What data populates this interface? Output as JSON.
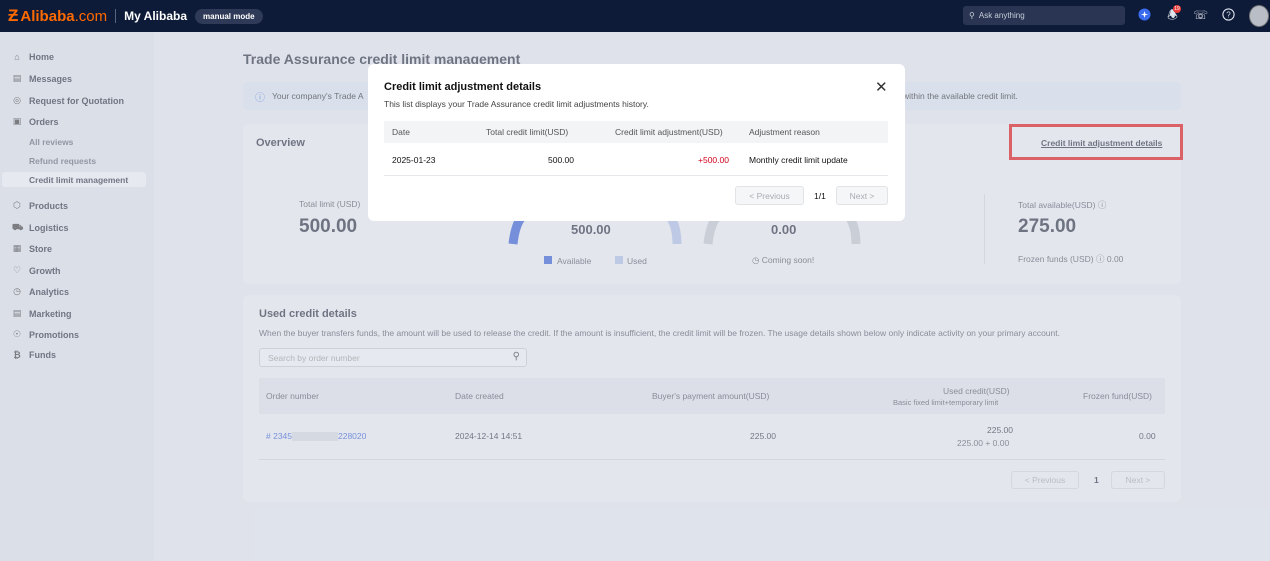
{
  "topbar": {
    "brand_mark": "Ƶ",
    "brand_name": "Alibaba",
    "brand_suffix": ".com",
    "app_name": "My Alibaba",
    "mode_pill": "manual mode",
    "search_placeholder": "Ask anything",
    "notification_count": "19"
  },
  "sidebar": {
    "items": [
      {
        "label": "Home",
        "icon": "home-icon"
      },
      {
        "label": "Messages",
        "icon": "message-icon"
      },
      {
        "label": "Request for Quotation",
        "icon": "rfq-icon"
      },
      {
        "label": "Orders",
        "icon": "orders-icon"
      },
      {
        "label": "Products",
        "icon": "products-icon"
      },
      {
        "label": "Logistics",
        "icon": "logistics-icon"
      },
      {
        "label": "Store",
        "icon": "store-icon"
      },
      {
        "label": "Growth",
        "icon": "growth-icon"
      },
      {
        "label": "Analytics",
        "icon": "analytics-icon"
      },
      {
        "label": "Marketing",
        "icon": "marketing-icon"
      },
      {
        "label": "Promotions",
        "icon": "promotions-icon"
      },
      {
        "label": "Funds",
        "icon": "funds-icon"
      }
    ],
    "sub_items": [
      "All reviews",
      "Refund requests",
      "Credit limit management"
    ]
  },
  "main": {
    "title": "Trade Assurance credit limit management",
    "notice_start": "Your company's Trade A",
    "notice_end": "within the available credit limit."
  },
  "overview": {
    "title": "Overview",
    "details_link": "Credit limit adjustment details",
    "total_limit_label": "Total limit (USD)",
    "total_limit_value": "500.00",
    "available_value": "500.00",
    "frozen_center_value": "0.00",
    "legend_available": "Available",
    "legend_used": "Used",
    "coming_soon": "Coming soon!",
    "total_available_label": "Total available(USD)",
    "total_available_value": "275.00",
    "frozen_funds_label": "Frozen funds (USD)",
    "frozen_funds_value": "0.00"
  },
  "used_credit": {
    "title": "Used credit details",
    "description": "When the buyer transfers funds, the amount will be used to release the credit. If the amount is insufficient, the credit limit will be frozen. The usage details shown below only indicate activity on your primary account.",
    "search_placeholder": "Search by order number",
    "headers": {
      "order_number": "Order number",
      "date_created": "Date created",
      "buyer_payment": "Buyer's payment amount(USD)",
      "used_credit": "Used credit(USD)",
      "used_credit_sub": "Basic fixed limit+temporary limit",
      "frozen_fund": "Frozen fund(USD)"
    },
    "row": {
      "order_prefix": "# 2345",
      "order_suffix": "228020",
      "date_created": "2024-12-14 14:51",
      "buyer_payment": "225.00",
      "used_credit": "225.00",
      "used_credit_breakdown": "225.00 + 0.00",
      "frozen_fund": "0.00"
    },
    "pager": {
      "previous": "< Previous",
      "page": "1",
      "next": "Next >"
    }
  },
  "modal": {
    "title": "Credit limit adjustment details",
    "subtitle": "This list displays your Trade Assurance credit limit adjustments history.",
    "headers": {
      "date": "Date",
      "total_credit_limit": "Total credit limit(USD)",
      "credit_limit_adjustment": "Credit limit adjustment(USD)",
      "adjustment_reason": "Adjustment reason"
    },
    "row": {
      "date": "2025-01-23",
      "total_credit_limit": "500.00",
      "credit_limit_adjustment": "+500.00",
      "adjustment_reason": "Monthly credit limit update"
    },
    "pager": {
      "previous": "< Previous",
      "page_info": "1/1",
      "next": "Next >"
    }
  },
  "colors": {
    "brand_orange": "#ff6a00",
    "topbar_navy": "#0d1a38",
    "available_blue": "#2a55d6",
    "used_lightblue": "#aebde8",
    "adjustment_red": "#d0021b",
    "highlight_red": "#e00000"
  }
}
